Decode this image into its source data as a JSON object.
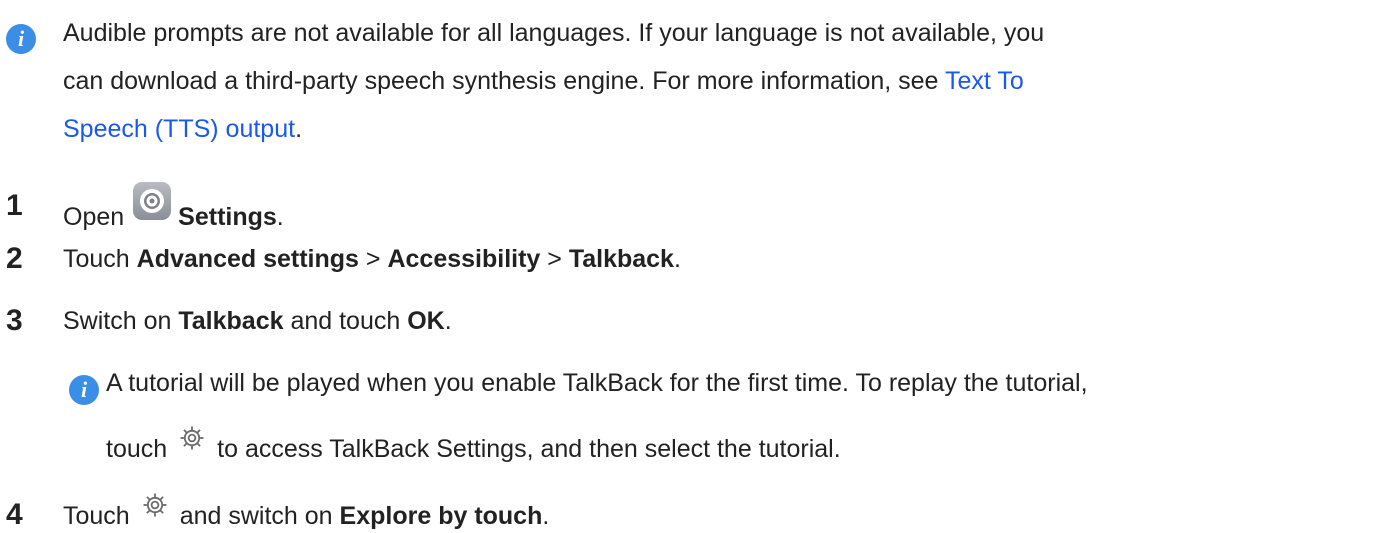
{
  "note1": {
    "line1": "Audible prompts are not available for all languages. If your language is not available, you",
    "line2_text": "can download a third-party speech synthesis engine. For more information, see ",
    "line2_link": "Text To",
    "line3_link": "Speech (TTS) output",
    "line3_tail": "."
  },
  "steps": [
    {
      "num": "1",
      "pre": "Open",
      "icon": "settings-app-icon",
      "bold1": "Settings",
      "post": "."
    },
    {
      "num": "2",
      "pre": "Touch ",
      "bold1": "Advanced settings",
      "sep1": " > ",
      "bold2": "Accessibility",
      "sep2": " > ",
      "bold3": "Talkback",
      "post": "."
    },
    {
      "num": "3",
      "pre": "Switch on ",
      "bold1": "Talkback",
      "mid": " and touch ",
      "bold2": "OK",
      "post": "."
    },
    {
      "num": "4",
      "pre": "Touch",
      "icon": "gear-icon",
      "mid": "and switch on ",
      "bold1": "Explore by touch",
      "post": "."
    }
  ],
  "note2": {
    "line1": "A tutorial will be played when you enable TalkBack for the first time. To replay the tutorial,",
    "line2_pre": "touch",
    "line2_icon": "gear-icon",
    "line2_post": "to access TalkBack Settings, and then select the tutorial."
  },
  "colors": {
    "info_icon": "#3a8ee6",
    "link": "#1a5ae8",
    "text": "#222222"
  }
}
